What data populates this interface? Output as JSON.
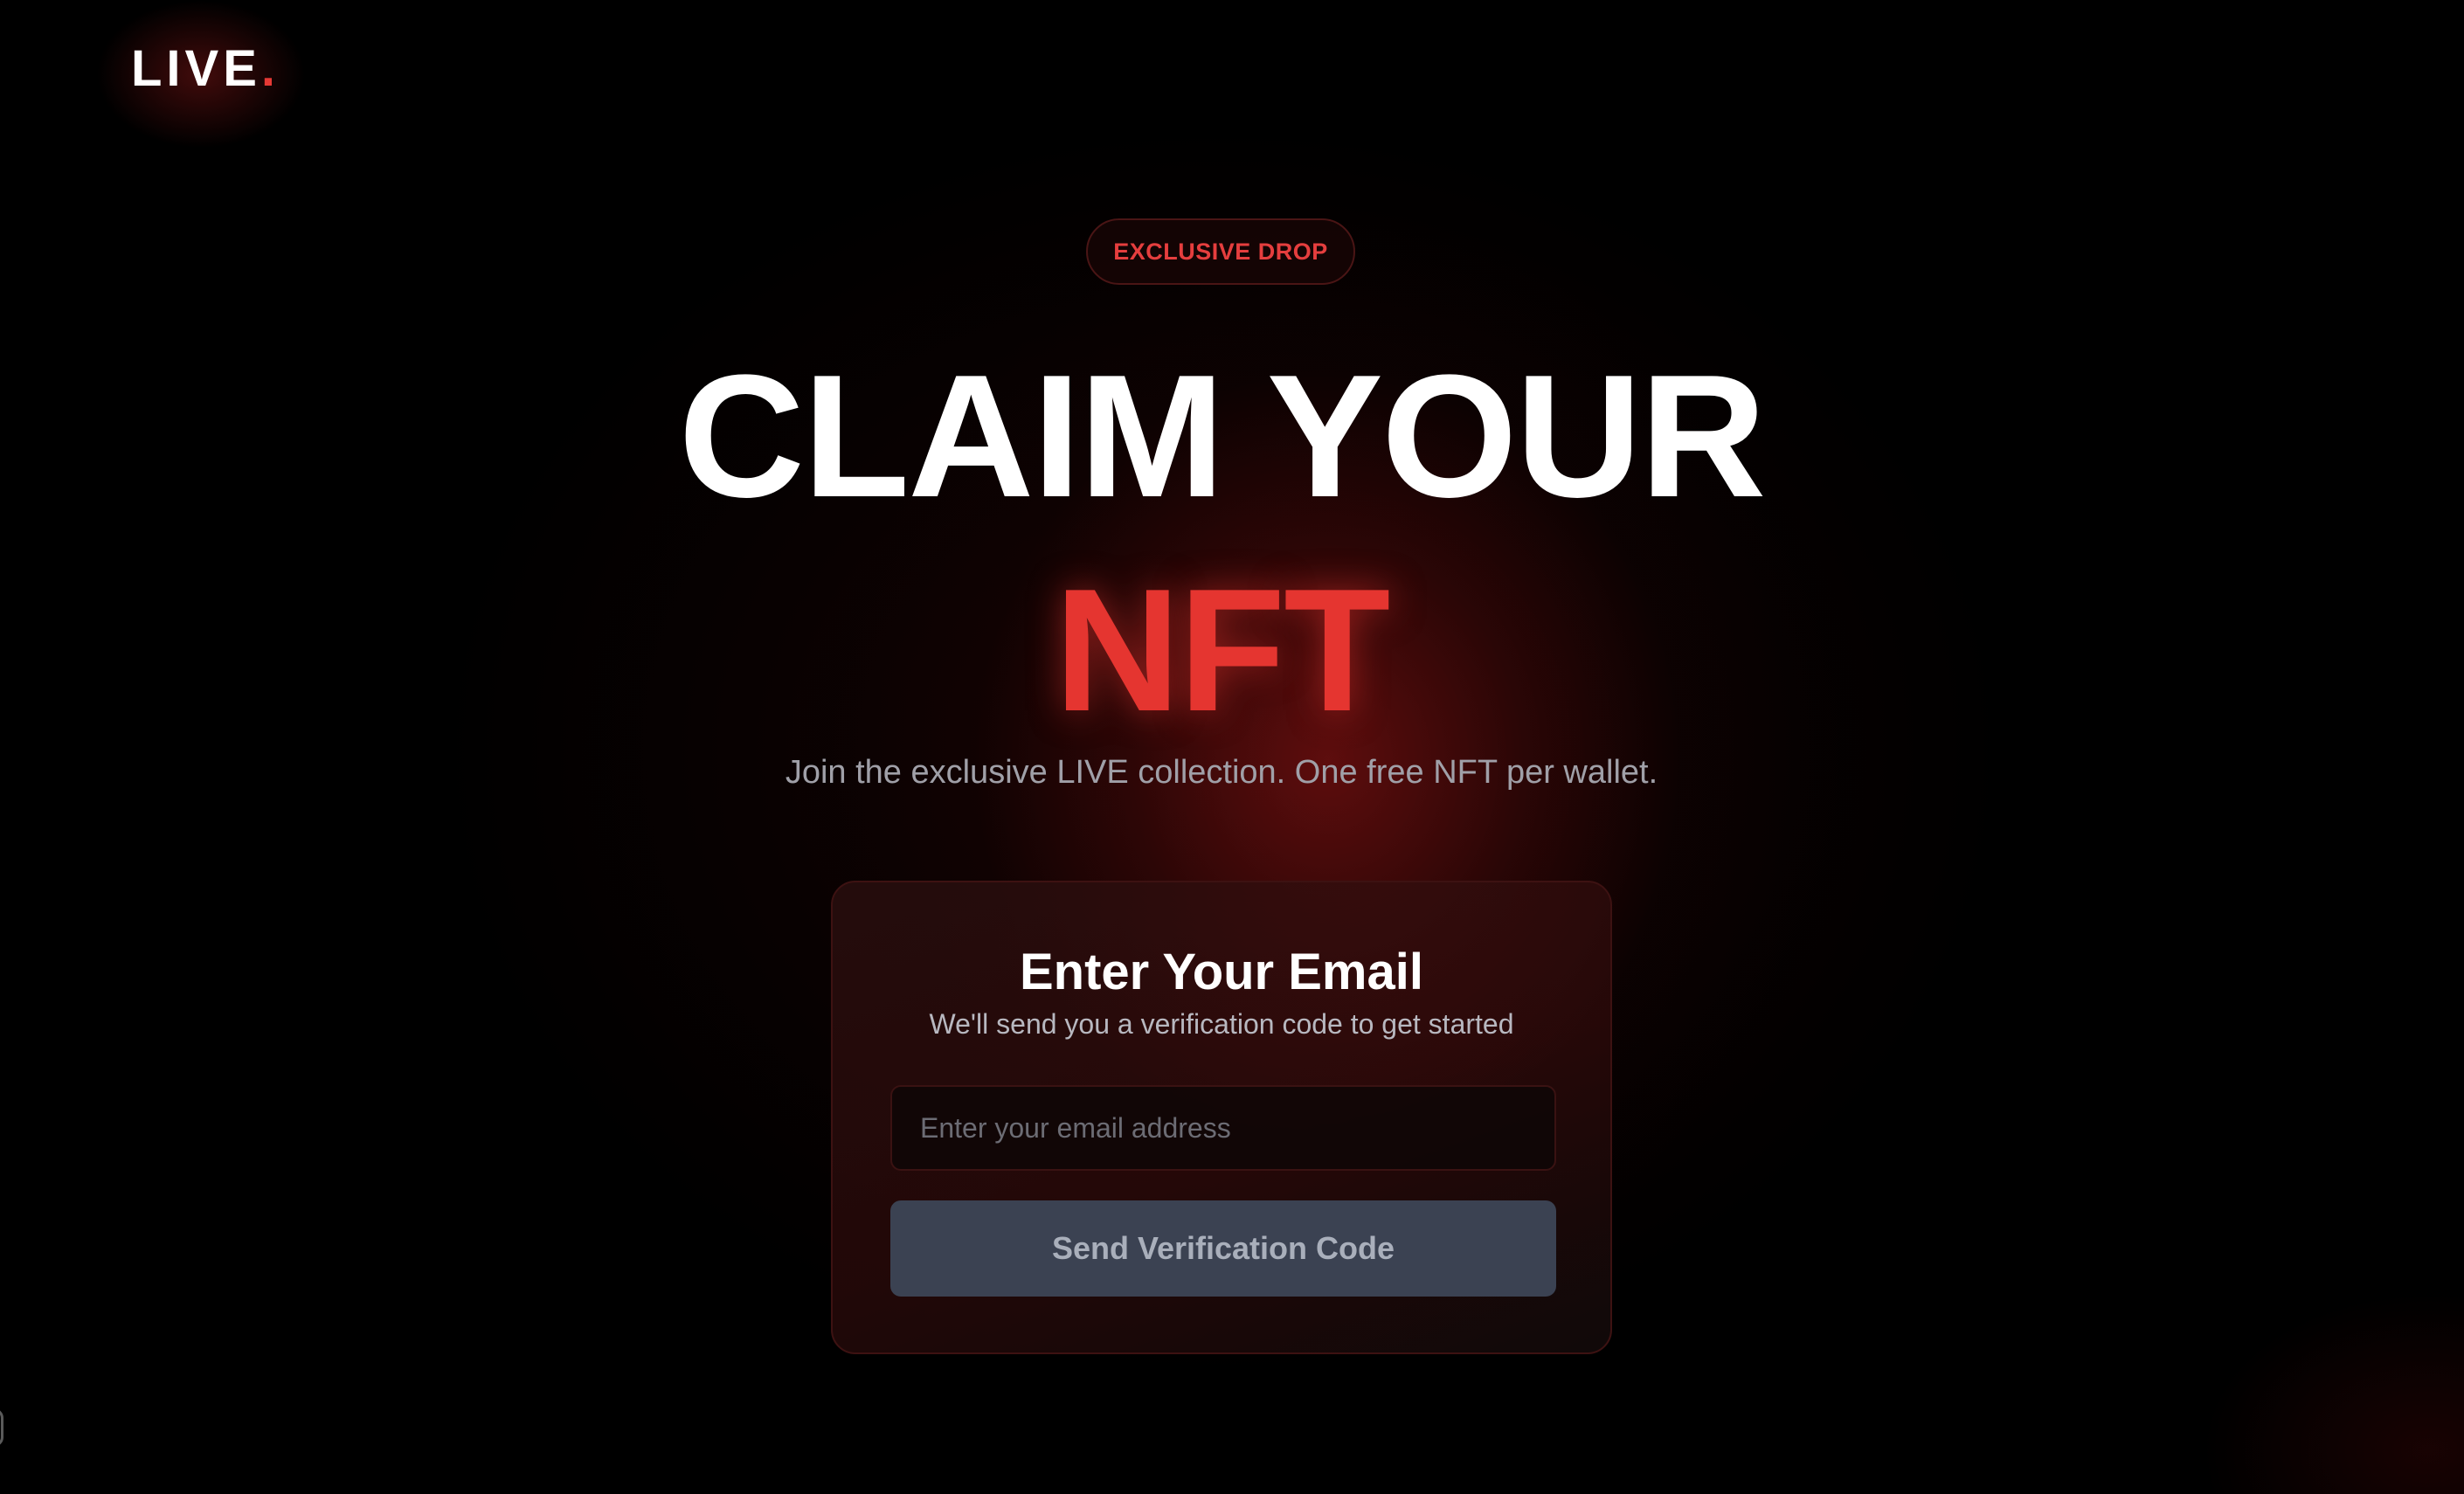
{
  "logo": {
    "text": "LIVE",
    "dot": "."
  },
  "badge": {
    "label": "EXCLUSIVE DROP"
  },
  "hero": {
    "headline": "CLAIM YOUR",
    "headline_accent": "NFT",
    "subtitle": "Join the exclusive LIVE collection. One free NFT per wallet."
  },
  "card": {
    "title": "Enter Your Email",
    "subtitle": "We'll send you a verification code to get started",
    "email_value": "",
    "email_placeholder": "Enter your email address",
    "button_label": "Send Verification Code"
  },
  "colors": {
    "background": "#000000",
    "accent": "#e53530",
    "button_bg": "#3b4252",
    "button_text": "#a9afbb",
    "subtitle_text": "#a0a0a8"
  }
}
